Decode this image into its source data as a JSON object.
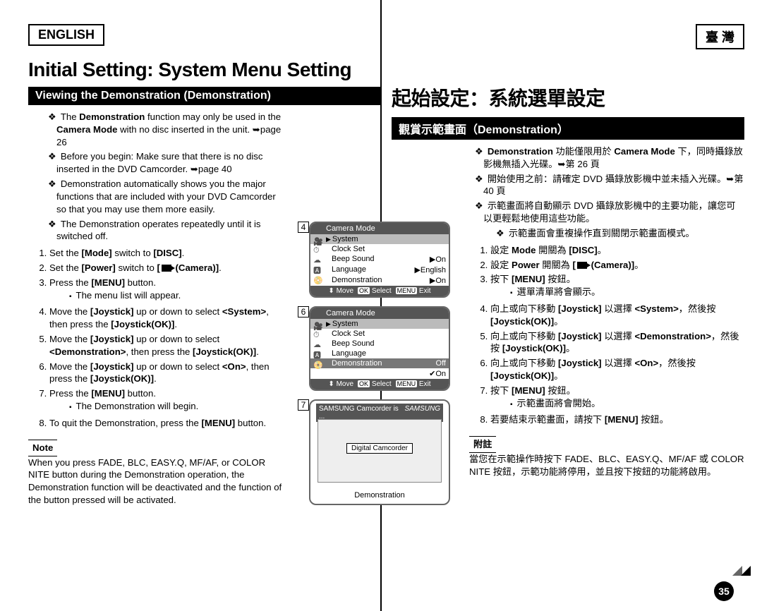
{
  "lang_left": "ENGLISH",
  "lang_right": "臺 灣",
  "title_left": "Initial Setting: System Menu Setting",
  "title_right": "起始設定：系統選單設定",
  "h2_left": "Viewing the Demonstration (Demonstration)",
  "h2_right": "觀賞示範畫面（Demonstration）",
  "page_number": "35",
  "left": {
    "intro": [
      "The Demonstration function may only be used in the Camera Mode with no disc inserted in the unit. ➥page 26",
      "Before you begin: Make sure that there is no disc inserted in the DVD Camcorder. ➥page 40",
      "Demonstration automatically shows you the major functions that are included with your DVD Camcorder so that you may use them more easily.",
      "The Demonstration operates repeatedly until it is switched off."
    ],
    "steps": [
      "Set the [Mode] switch to [DISC].",
      "Set the [Power] switch to [ 🎥 (Camera)].",
      "Press the [MENU] button.",
      "The menu list will appear.",
      "Move the [Joystick] up or down to select <System>, then press the [Joystick(OK)].",
      "Move the [Joystick] up or down to select <Demonstration>, then press the [Joystick(OK)].",
      "Move the [Joystick] up or down to select <On>, then press the [Joystick(OK)].",
      "Press the [MENU] button.",
      "The Demonstration will begin.",
      "To quit the Demonstration, press the [MENU] button."
    ],
    "note_label": "Note",
    "note_text": "When you press FADE, BLC, EASY.Q, MF/AF, or COLOR NITE button during the Demonstration operation, the Demonstration function will be deactivated and the function of the button pressed will be activated."
  },
  "right": {
    "intro": [
      "Demonstration 功能僅限用於 Camera Mode 下，同時攝錄放影機無插入光碟。➥第 26 頁",
      "開始使用之前：請確定 DVD 攝錄放影機中並未插入光碟。➥第 40 頁",
      "示範畫面將自動顯示 DVD 攝錄放影機中的主要功能，讓您可以更輕鬆地使用這些功能。",
      "示範畫面會重複操作直到關閉示範畫面模式。"
    ],
    "steps": [
      "設定 Mode 開關為 [DISC]。",
      "設定 Power 開關為 [ 🎥 (Camera)]。",
      "按下 [MENU] 按鈕。",
      "選單清單將會顯示。",
      "向上或向下移動 [Joystick] 以選擇 <System>，然後按 [Joystick(OK)]。",
      "向上或向下移動 [Joystick] 以選擇 <Demonstration>，然後按 [Joystick(OK)]。",
      "向上或向下移動 [Joystick] 以選擇 <On>，然後按 [Joystick(OK)]。",
      "按下 [MENU] 按鈕。",
      "示範畫面將會開始。",
      "若要結束示範畫面，請按下 [MENU] 按鈕。"
    ],
    "note_label": "附註",
    "note_text": "當您在示範操作時按下 FADE、BLC、EASY.Q、MF/AF 或 COLOR NITE 按鈕，示範功能將停用，並且按下按鈕的功能將啟用。"
  },
  "figures": {
    "label4": "4",
    "label6": "6",
    "label7": "7",
    "screen1": {
      "title": "Camera Mode",
      "section": "System",
      "rows": [
        {
          "label": "Clock Set",
          "value": ""
        },
        {
          "label": "Beep Sound",
          "value": "▶On"
        },
        {
          "label": "Language",
          "value": "▶English"
        },
        {
          "label": "Demonstration",
          "value": "▶On"
        }
      ],
      "footer": {
        "move": "Move",
        "select": "Select",
        "exit": "Exit",
        "ok": "OK",
        "menu": "MENU"
      }
    },
    "screen2": {
      "title": "Camera Mode",
      "section": "System",
      "rows": [
        {
          "label": "Clock Set",
          "value": ""
        },
        {
          "label": "Beep Sound",
          "value": ""
        },
        {
          "label": "Language",
          "value": ""
        },
        {
          "label": "Demonstration",
          "value": "Off",
          "sel": true
        },
        {
          "label": "",
          "value": "✔On"
        }
      ],
      "footer": {
        "move": "Move",
        "select": "Select",
        "exit": "Exit",
        "ok": "OK",
        "menu": "MENU"
      }
    },
    "promo": {
      "title": "SAMSUNG Camcorder is ...",
      "brand": "SAMSUNG",
      "label": "Digital Camcorder",
      "foot": "Demonstration"
    }
  }
}
